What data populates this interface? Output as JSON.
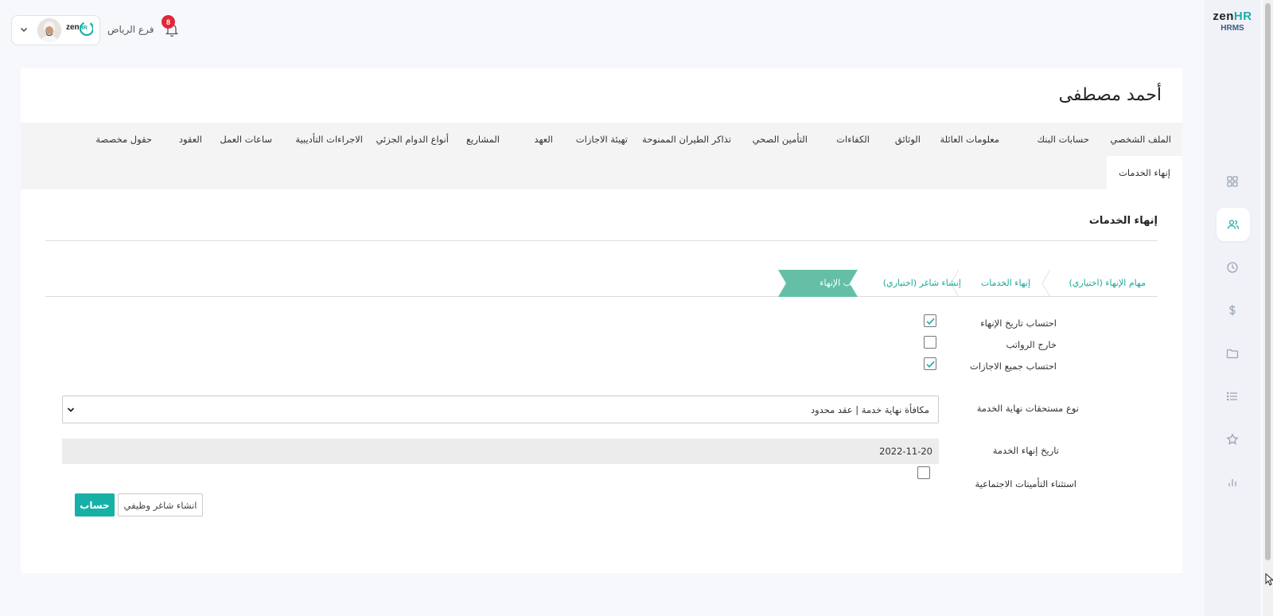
{
  "app": {
    "logo_primary": "zen",
    "logo_accent": "HR",
    "logo_sub": "HRMS"
  },
  "sidebar": {
    "items": [
      {
        "icon": "dashboard-grid-icon",
        "active": false
      },
      {
        "icon": "users-icon",
        "active": true
      },
      {
        "icon": "clock-icon",
        "active": false
      },
      {
        "icon": "dollar-icon",
        "active": false
      },
      {
        "icon": "folder-icon",
        "active": false
      },
      {
        "icon": "list-icon",
        "active": false
      },
      {
        "icon": "star-icon",
        "active": false
      },
      {
        "icon": "bar-chart-icon",
        "active": false
      }
    ]
  },
  "header": {
    "branch": "فرع الرياض",
    "notification_count": "8",
    "company_logo_primary": "zen",
    "company_logo_accent": "HR"
  },
  "employee": {
    "name": "أحمد مصطفى"
  },
  "tabs": {
    "row1": [
      "الملف الشخصي",
      "حسابات البنك",
      "معلومات العائلة",
      "الوثائق",
      "الكفاءات",
      "التأمين الصحي",
      "تذاكر الطيران الممنوحة",
      "تهيئة الاجازات",
      "العهد",
      "المشاريع",
      "أنواع الدوام الجزئي",
      "الاجراءات التأديبية",
      "ساعات العمل",
      "العقود",
      "حقول مخصصة"
    ],
    "row2": [
      "إنهاء الخدمات"
    ],
    "active": "إنهاء الخدمات"
  },
  "section": {
    "title": "إنهاء الخدمات"
  },
  "steps": {
    "items": [
      "مهام الإنهاء (اختياري)",
      "إنهاء الخدمات",
      "إنشاء شاغر (اختياري)",
      "راتب الإنهاء"
    ],
    "active_index": 3
  },
  "form": {
    "checkboxes": [
      {
        "label": "احتساب تاريخ الإنهاء",
        "checked": true
      },
      {
        "label": "خارج الرواتب",
        "checked": false
      },
      {
        "label": "احتساب جميع الاجازات",
        "checked": true
      }
    ],
    "end_of_service_type": {
      "label": "نوع مستحقات نهاية الخدمة",
      "value": "مكافأة نهاية خدمة | عقد محدود"
    },
    "termination_date": {
      "label": "تاريخ إنهاء الخدمة",
      "value": "2022-11-20"
    },
    "exclude_social_insurance": {
      "label": "استثناء التأمينات الاجتماعية",
      "checked": false
    }
  },
  "buttons": {
    "calculate": "حساب",
    "create_vacancy": "انشاء شاغر وظيفي"
  },
  "colors": {
    "accent": "#17b0a7",
    "step_active_bg": "#64bfa6",
    "badge": "#e0283a"
  }
}
